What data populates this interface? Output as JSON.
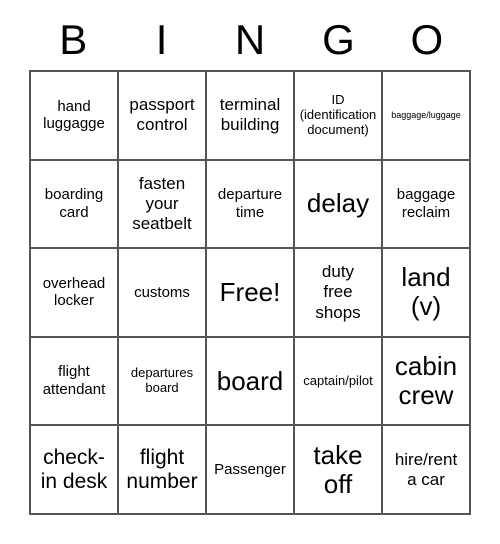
{
  "header": {
    "letters": [
      "B",
      "I",
      "N",
      "G",
      "O"
    ]
  },
  "grid": {
    "rows": [
      [
        {
          "text": "hand\nluggagge",
          "size": "sz-m"
        },
        {
          "text": "passport\ncontrol",
          "size": "sz-l"
        },
        {
          "text": "terminal\nbuilding",
          "size": "sz-l"
        },
        {
          "text": "ID\n(identification\ndocument)",
          "size": "sz-s"
        },
        {
          "text": "baggage/luggage",
          "size": "sz-xs"
        }
      ],
      [
        {
          "text": "boarding\ncard",
          "size": "sz-m"
        },
        {
          "text": "fasten\nyour\nseatbelt",
          "size": "sz-l"
        },
        {
          "text": "departure\ntime",
          "size": "sz-m"
        },
        {
          "text": "delay",
          "size": "sz-xxl"
        },
        {
          "text": "baggage\nreclaim",
          "size": "sz-m"
        }
      ],
      [
        {
          "text": "overhead\nlocker",
          "size": "sz-m"
        },
        {
          "text": "customs",
          "size": "sz-m"
        },
        {
          "text": "Free!",
          "size": "sz-xxl"
        },
        {
          "text": "duty\nfree\nshops",
          "size": "sz-l"
        },
        {
          "text": "land\n(v)",
          "size": "sz-xxl"
        }
      ],
      [
        {
          "text": "flight\nattendant",
          "size": "sz-m"
        },
        {
          "text": "departures\nboard",
          "size": "sz-s"
        },
        {
          "text": "board",
          "size": "sz-xxl"
        },
        {
          "text": "captain/pilot",
          "size": "sz-s"
        },
        {
          "text": "cabin\ncrew",
          "size": "sz-xxl"
        }
      ],
      [
        {
          "text": "check-\nin desk",
          "size": "sz-xl"
        },
        {
          "text": "flight\nnumber",
          "size": "sz-xl"
        },
        {
          "text": "Passenger",
          "size": "sz-m"
        },
        {
          "text": "take\noff",
          "size": "sz-xxl"
        },
        {
          "text": "hire/rent\na car",
          "size": "sz-l"
        }
      ]
    ]
  },
  "colors": {
    "background": "#ffffff",
    "text": "#000000",
    "gridline": "#555555"
  }
}
